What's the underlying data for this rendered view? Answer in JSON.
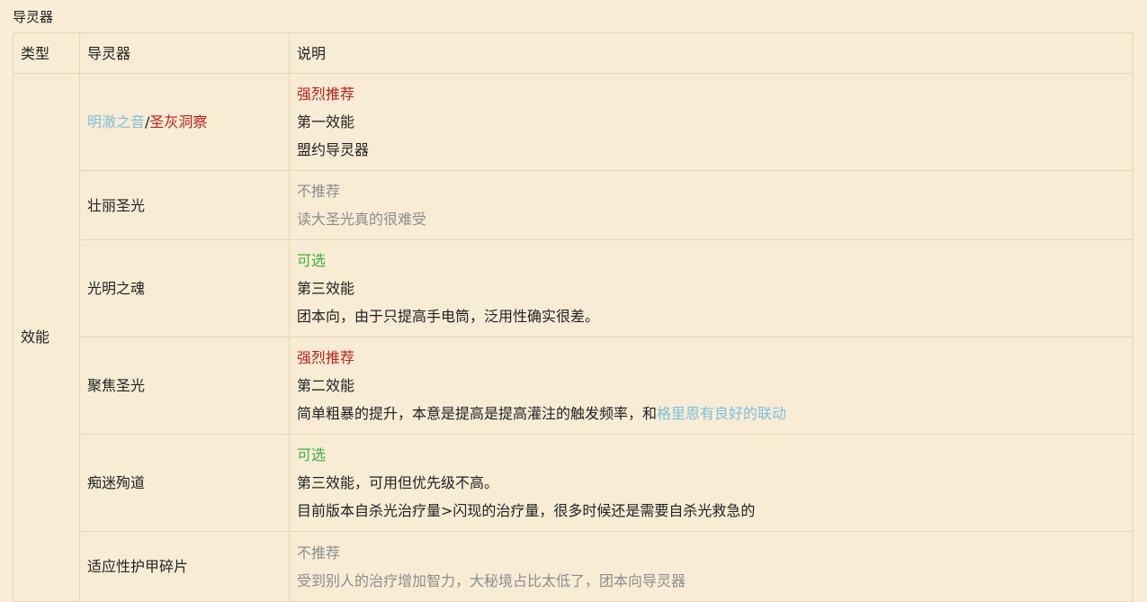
{
  "page": {
    "title": "导灵器"
  },
  "table": {
    "headers": [
      "类型",
      "导灵器",
      "说明"
    ],
    "type_label": "效能",
    "rows": [
      {
        "name_parts": [
          {
            "text": "明澈之音",
            "color": "#7ec0dc"
          },
          {
            "text": "/",
            "color": "#222222"
          },
          {
            "text": "圣灰洞察",
            "color": "#c0201a"
          }
        ],
        "lines": [
          [
            {
              "text": "强烈推荐",
              "color": "#c0201a"
            }
          ],
          [
            {
              "text": "第一效能",
              "color": "#222222"
            }
          ],
          [
            {
              "text": "盟约导灵器",
              "color": "#222222"
            }
          ]
        ]
      },
      {
        "name": "壮丽圣光",
        "lines": [
          [
            {
              "text": "不推荐",
              "color": "#8d8d8d"
            }
          ],
          [
            {
              "text": "读大圣光真的很难受",
              "color": "#8d8d8d"
            }
          ]
        ]
      },
      {
        "name": "光明之魂",
        "lines": [
          [
            {
              "text": "可选",
              "color": "#3db03d"
            }
          ],
          [
            {
              "text": "第三效能",
              "color": "#222222"
            }
          ],
          [
            {
              "text": "团本向，由于只提高手电筒，泛用性确实很差。",
              "color": "#222222"
            }
          ]
        ]
      },
      {
        "name": "聚焦圣光",
        "lines": [
          [
            {
              "text": "强烈推荐",
              "color": "#c0201a"
            }
          ],
          [
            {
              "text": "第二效能",
              "color": "#222222"
            }
          ],
          [
            {
              "text": "简单粗暴的提升，本意是提高是提高灌注的触发频率，和",
              "color": "#222222"
            },
            {
              "text": "格里恩有良好的联动",
              "color": "#7ec0dc"
            }
          ]
        ]
      },
      {
        "name": "痴迷殉道",
        "lines": [
          [
            {
              "text": "可选",
              "color": "#3db03d"
            }
          ],
          [
            {
              "text": "第三效能，可用但优先级不高。",
              "color": "#222222"
            }
          ],
          [
            {
              "text": "目前版本自杀光治疗量>闪现的治疗量，很多时候还是需要自杀光救急的",
              "color": "#222222"
            }
          ]
        ]
      },
      {
        "name": "适应性护甲碎片",
        "lines": [
          [
            {
              "text": "不推荐",
              "color": "#8d8d8d"
            }
          ],
          [
            {
              "text": "受到别人的治疗增加智力，大秘境占比太低了，团本向导灵器",
              "color": "#8d8d8d"
            }
          ]
        ]
      }
    ]
  }
}
